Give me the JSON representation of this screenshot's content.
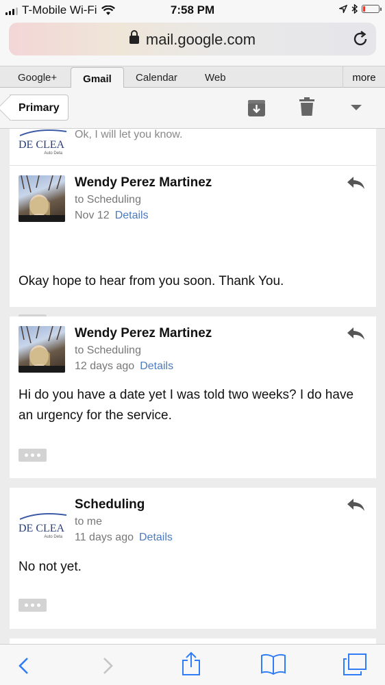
{
  "status": {
    "carrier": "T-Mobile Wi-Fi",
    "time": "7:58 PM",
    "battery_level": 0.12,
    "colors": {
      "battery_low": "#e03a2f"
    }
  },
  "browser": {
    "url": "mail.google.com",
    "icons": [
      "lock-icon",
      "reload-icon"
    ]
  },
  "google_nav": {
    "items": [
      "Google+",
      "Gmail",
      "Calendar",
      "Web"
    ],
    "active": "Gmail",
    "more_label": "more"
  },
  "toolbar": {
    "back_label": "Primary",
    "icons": [
      "archive-icon",
      "trash-icon",
      "dropdown-arrow-icon"
    ]
  },
  "messages": [
    {
      "snippet": "Ok, I will let you know.",
      "logo_text": "DE CLEA",
      "logo_sub": "Auto Deta"
    },
    {
      "sender": "Wendy Perez Martinez",
      "to": "to Scheduling",
      "date": "Nov 12",
      "details_label": "Details",
      "body": "Okay hope to hear from you soon. Thank You."
    },
    {
      "sender": "Wendy Perez Martinez",
      "to": "to Scheduling",
      "date": "12 days ago",
      "details_label": "Details",
      "body": "Hi do you have a date yet I was told two weeks? I do have an urgency for the service."
    },
    {
      "sender": "Scheduling",
      "to": "to me",
      "date": "11 days ago",
      "details_label": "Details",
      "body": "No not yet.",
      "logo_text": "DE CLEA",
      "logo_sub": "Auto Deta"
    }
  ],
  "bottom_bar": {
    "icons": [
      "back-arrow-icon",
      "forward-arrow-icon",
      "share-icon",
      "bookmarks-icon",
      "tabs-icon"
    ]
  },
  "colors": {
    "link": "#4b7bbf",
    "ios_blue": "#2f7cf6"
  }
}
